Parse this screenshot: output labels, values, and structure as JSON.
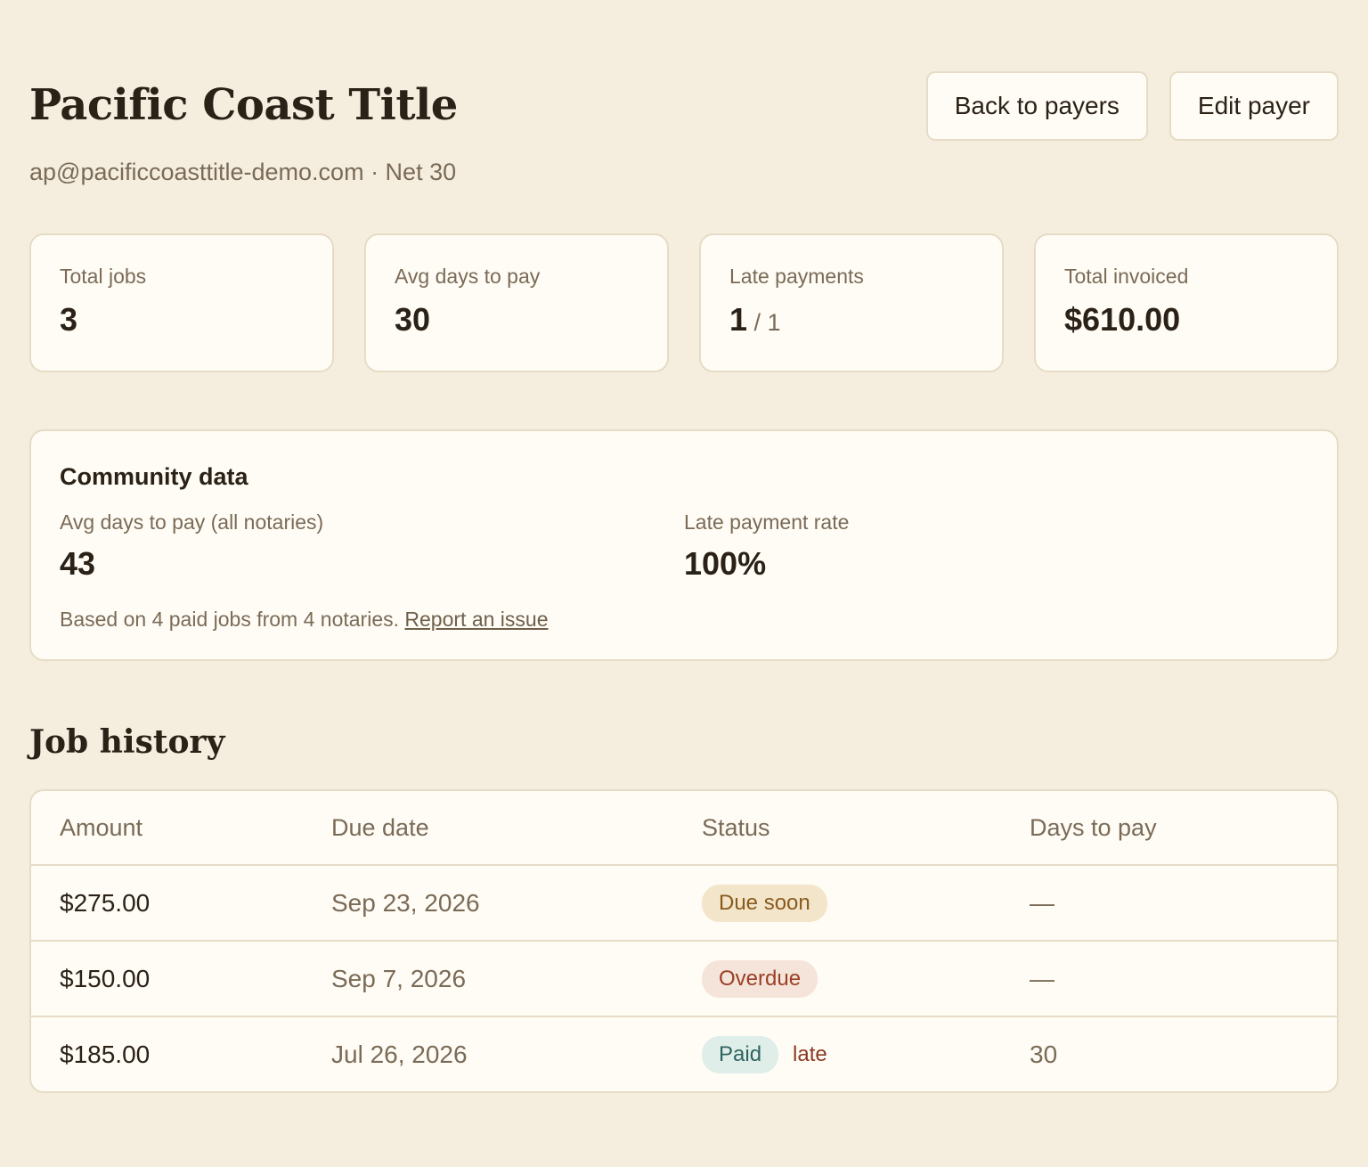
{
  "header": {
    "title": "Pacific Coast Title",
    "subtitle": "ap@pacificcoasttitle-demo.com · Net 30",
    "back_label": "Back to payers",
    "edit_label": "Edit payer"
  },
  "stats": [
    {
      "label": "Total jobs",
      "value": "3",
      "sub": ""
    },
    {
      "label": "Avg days to pay",
      "value": "30",
      "sub": ""
    },
    {
      "label": "Late payments",
      "value": "1",
      "sub": " / 1"
    },
    {
      "label": "Total invoiced",
      "value": "$610.00",
      "sub": ""
    }
  ],
  "community": {
    "title": "Community data",
    "avg_label": "Avg days to pay (all notaries)",
    "avg_value": "43",
    "rate_label": "Late payment rate",
    "rate_value": "100%",
    "note": "Based on 4 paid jobs from 4 notaries.",
    "report_link": "Report an issue"
  },
  "history": {
    "title": "Job history",
    "columns": [
      "Amount",
      "Due date",
      "Status",
      "Days to pay"
    ],
    "rows": [
      {
        "amount": "$275.00",
        "due": "Sep 23, 2026",
        "status": "Due soon",
        "late": "",
        "days": "—"
      },
      {
        "amount": "$150.00",
        "due": "Sep 7, 2026",
        "status": "Overdue",
        "late": "",
        "days": "—"
      },
      {
        "amount": "$185.00",
        "due": "Jul 26, 2026",
        "status": "Paid",
        "late": "late",
        "days": "30"
      }
    ]
  },
  "colors": {
    "background": "#f5eedf",
    "card": "#fffcf5",
    "due_soon": "#f2e5c9",
    "overdue": "#f5e4da",
    "paid": "#dfeee9"
  }
}
